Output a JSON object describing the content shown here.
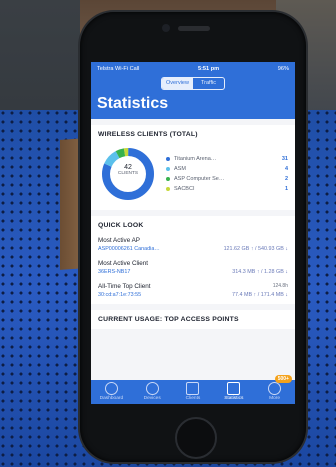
{
  "status_bar": {
    "carrier": "Telstra Wi-Fi Call",
    "time": "5:51 pm",
    "battery": "96%"
  },
  "segmented": {
    "overview": "Overview",
    "traffic": "Traffic"
  },
  "page_title": "Statistics",
  "wireless": {
    "heading": "WIRELESS CLIENTS (TOTAL)",
    "total": "42",
    "total_label": "CLIENTS",
    "legend": [
      {
        "name": "Titanium Arena…",
        "count": "31",
        "color": "#2f6fd8",
        "share": 0.738
      },
      {
        "name": "ASM",
        "count": "4",
        "color": "#5bc0eb",
        "share": 0.095
      },
      {
        "name": "ASP Computer Se…",
        "count": "2",
        "color": "#37b24d",
        "share": 0.048
      },
      {
        "name": "SACBCI",
        "count": "1",
        "color": "#c6d83a",
        "share": 0.024
      }
    ]
  },
  "quick_look": {
    "heading": "QUICK LOOK",
    "most_active_ap": {
      "label": "Most Active AP",
      "name": "ASP00006261 Canadia…",
      "value": "121.62 GB ↑ / 540.93 GB ↓"
    },
    "most_active_client": {
      "label": "Most Active Client",
      "name": "36ERS-NB17",
      "value": "314.3 MB ↑ / 1.28 GB ↓"
    },
    "all_time_top_client": {
      "label": "All-Time Top Client",
      "duration": "124.8h",
      "name": "30:cd:a7:1e:73:55",
      "value": "77.4 MB ↑ / 171.4 MB ↓"
    }
  },
  "current_usage": {
    "heading": "CURRENT USAGE: TOP ACCESS POINTS"
  },
  "tabs": [
    {
      "label": "Dashboard"
    },
    {
      "label": "Devices"
    },
    {
      "label": "Clients"
    },
    {
      "label": "Statistics"
    },
    {
      "label": "More",
      "badge": "500+"
    }
  ]
}
